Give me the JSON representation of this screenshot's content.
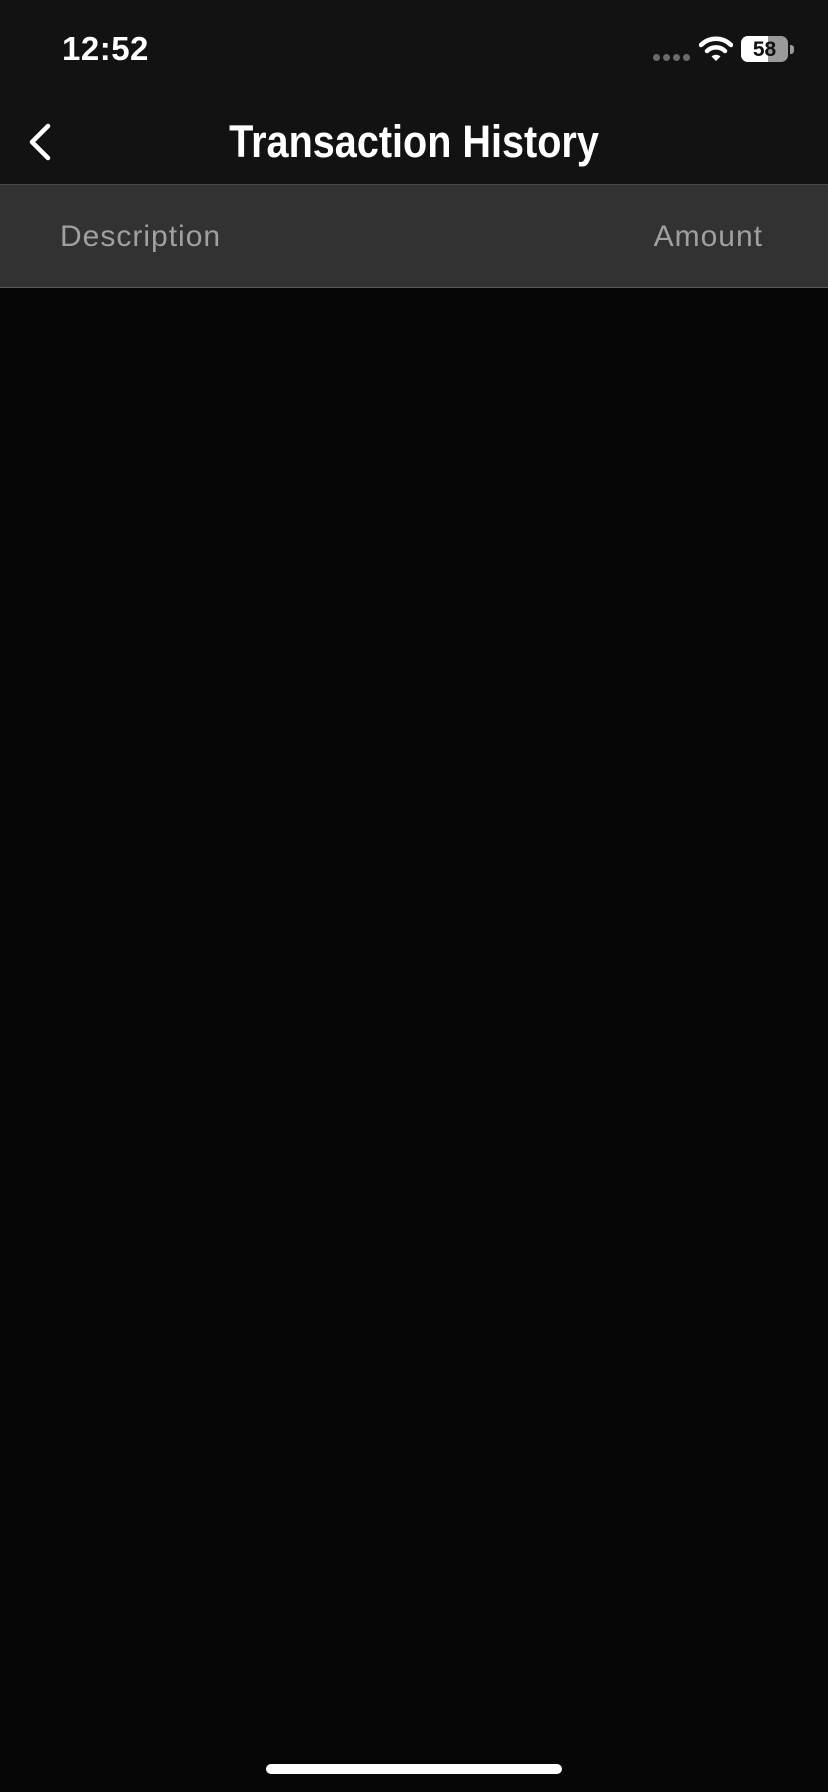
{
  "status_bar": {
    "time": "12:52",
    "battery_level": "58",
    "battery_fraction": 0.58,
    "wifi_icon": "wifi-icon",
    "signal_icon": "cellular-signal-icon"
  },
  "nav": {
    "title": "Transaction History",
    "back_icon": "chevron-left-icon"
  },
  "table": {
    "columns": [
      "Description",
      "Amount"
    ],
    "rows": []
  },
  "colors": {
    "background": "#060606",
    "top_bar": "#121212",
    "header_row": "#323232",
    "header_text": "#a0a0a0",
    "title_text": "#ffffff"
  }
}
